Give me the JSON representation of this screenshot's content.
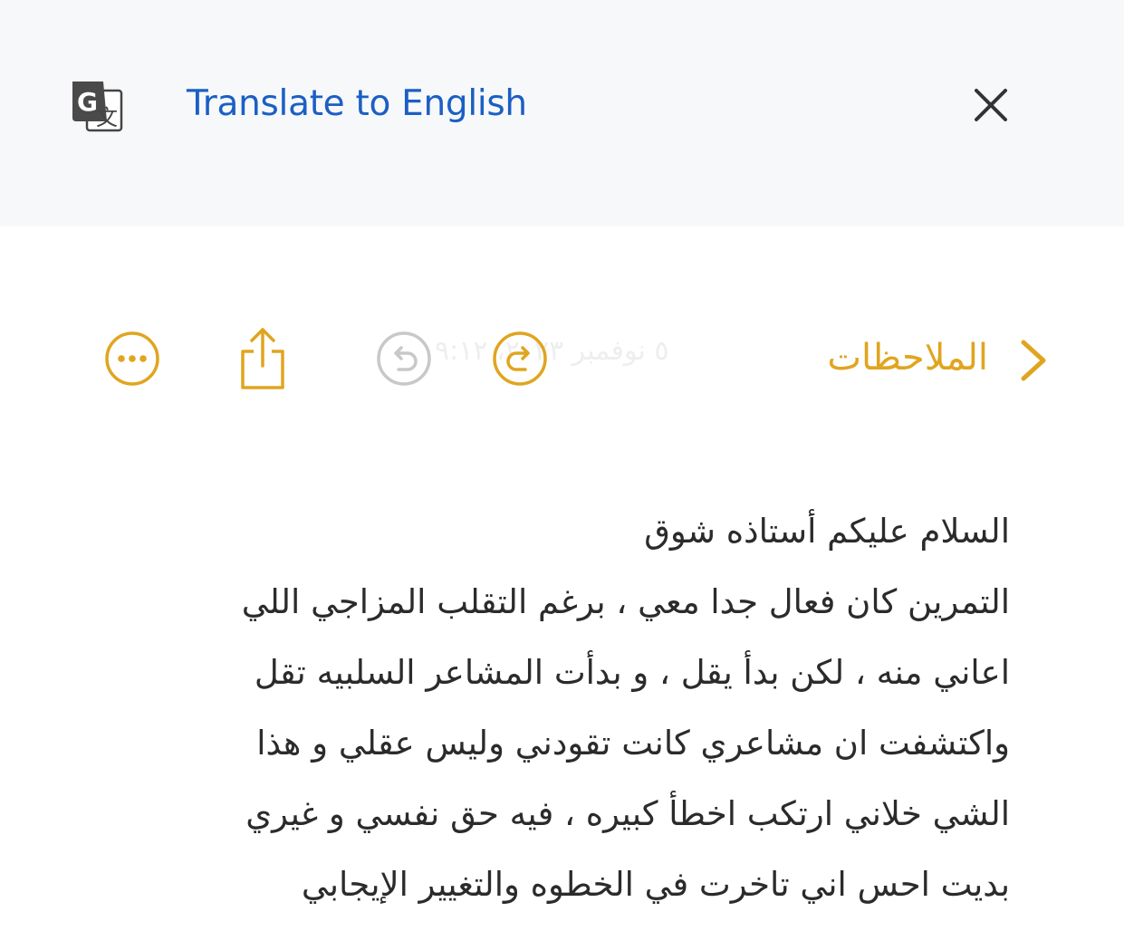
{
  "translate_bar": {
    "icon": "google-translate-icon",
    "label": "Translate to English",
    "close_icon": "close-icon",
    "label_color": "#1b5fc4"
  },
  "toolbar": {
    "back_label": "الملاحظات",
    "back_icon": "chevron-icon",
    "faded_date": "٥ نوفمبر ٢٠٢٣، ٩:١٢",
    "icons": [
      "more-icon",
      "share-icon",
      "undo-icon",
      "redo-icon"
    ],
    "accent_color": "#e0a51f",
    "disabled_color": "#c8c8c8"
  },
  "note": {
    "lines": [
      "السلام عليكم أستاذه شوق",
      "التمرين كان فعال جدا معي ، برغم التقلب المزاجي اللي",
      "اعاني منه ، لكن بدأ يقل ، و بدأت المشاعر السلبيه تقل",
      "واكتشفت ان مشاعري كانت تقودني وليس عقلي و هذا",
      "الشي خلاني ارتكب اخطأ كبيره ، فيه حق نفسي و غيري",
      "بديت احس اني تاخرت في الخطوه والتغيير الإيجابي"
    ]
  }
}
